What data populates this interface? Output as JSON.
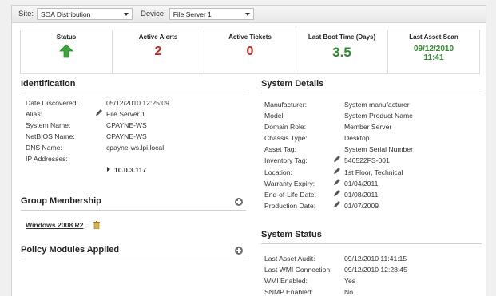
{
  "selectors": {
    "site_label": "Site:",
    "site_value": "SOA Distribution",
    "device_label": "Device:",
    "device_value": "File Server 1"
  },
  "stats": {
    "status_label": "Status",
    "status_icon": "up-arrow-icon",
    "alerts_label": "Active Alerts",
    "alerts_value": "2",
    "tickets_label": "Active Tickets",
    "tickets_value": "0",
    "boot_label": "Last Boot Time (Days)",
    "boot_value": "3.5",
    "scan_label": "Last Asset Scan",
    "scan_date": "09/12/2010",
    "scan_time": "11:41"
  },
  "identification": {
    "title": "Identification",
    "rows": [
      {
        "label": "Date Discovered:",
        "value": "05/12/2010 12:25:09"
      },
      {
        "label": "Alias:",
        "value": "File Server 1"
      },
      {
        "label": "System Name:",
        "value": "CPAYNE-WS"
      },
      {
        "label": "NetBIOS Name:",
        "value": "CPAYNE-WS"
      },
      {
        "label": "DNS Name:",
        "value": "cpayne-ws.lpi.local"
      },
      {
        "label": "IP Addresses:",
        "value": ""
      }
    ],
    "ip": "10.0.3.117"
  },
  "group_membership": {
    "title": "Group Membership",
    "item": "Windows 2008 R2"
  },
  "policy_modules": {
    "title": "Policy Modules Applied"
  },
  "system_details": {
    "title": "System Details",
    "rows": [
      {
        "label": "Manufacturer:",
        "value": "System manufacturer"
      },
      {
        "label": "Model:",
        "value": "System Product Name"
      },
      {
        "label": "Domain Role:",
        "value": "Member Server"
      },
      {
        "label": "Chassis Type:",
        "value": "Desktop"
      },
      {
        "label": "Asset Tag:",
        "value": "System Serial Number"
      },
      {
        "label": "Inventory Tag:",
        "value": "546522FS-001"
      },
      {
        "label": "Location:",
        "value": "1st Floor, Technical"
      },
      {
        "label": "Warranty Expiry:",
        "value": "01/04/2011"
      },
      {
        "label": "End-of-Life Date:",
        "value": "01/08/2011"
      },
      {
        "label": "Production Date:",
        "value": "01/07/2009"
      }
    ]
  },
  "system_status": {
    "title": "System Status",
    "rows": [
      {
        "label": "Last Asset Audit:",
        "value": "09/12/2010 11:41:15"
      },
      {
        "label": "Last WMI Connection:",
        "value": "09/12/2010 12:28:45"
      },
      {
        "label": "WMI Enabled:",
        "value": "Yes"
      },
      {
        "label": "SNMP Enabled:",
        "value": "No"
      }
    ]
  }
}
